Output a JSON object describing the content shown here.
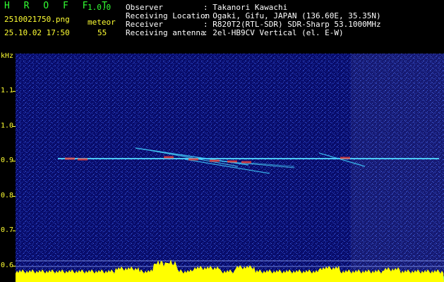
{
  "header": {
    "app_name": "H R O F F T",
    "version": "1.0.0",
    "filename": "2510021750.png",
    "mode_label": "meteor",
    "timestamp": "25.10.02 17:50",
    "meteor_count": "55",
    "info_labels": [
      "Observer",
      "Receiving Location",
      "Receiver",
      "Receiving antenna"
    ],
    "info_values": [
      ": Takanori Kawachi",
      ": Ogaki, Gifu, JAPAN (136.60E, 35.35N)",
      ": R820T2(RTL-SDR) SDR-Sharp 53.1000MHz",
      ": 2el-HB9CV Vertical (el. E-W)"
    ]
  },
  "axes": {
    "y_unit": "kHz",
    "y_ticks": [
      "1.1",
      "1.0",
      "0.9",
      "0.8",
      "0.7",
      "0.6"
    ],
    "x_ticks": [
      "1751",
      "1752",
      "1753",
      "1754",
      "1755",
      "1756",
      "1757",
      "1758",
      "1759",
      "1800"
    ]
  },
  "colors": {
    "header_green": "#33ff33",
    "axis_yellow": "#ffff33",
    "background_blue": "#080c6a",
    "trace_cyan": "#40d0ff",
    "level_yellow": "#ffff00",
    "level_cyan": "#00ffff"
  }
}
